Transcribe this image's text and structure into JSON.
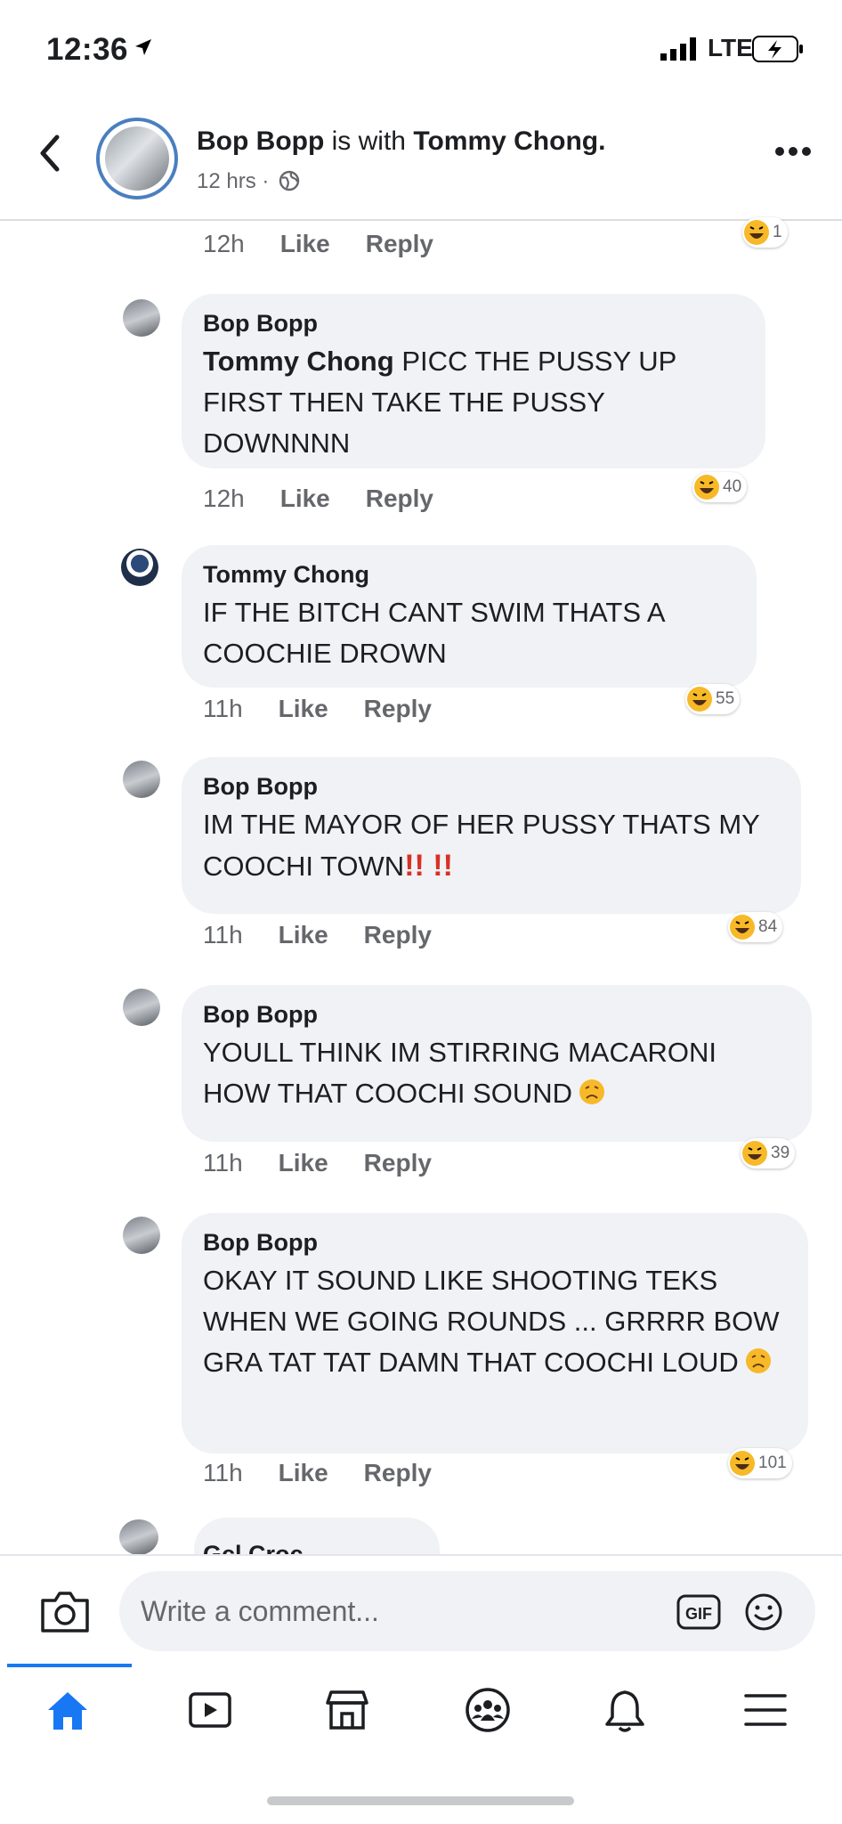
{
  "status_bar": {
    "time": "12:36",
    "network": "LTE"
  },
  "header": {
    "author": "Bop Bopp",
    "with_text": "is with",
    "tagged": "Tommy Chong.",
    "meta": "12 hrs ·"
  },
  "top_row": {
    "time": "12h",
    "like": "Like",
    "reply": "Reply",
    "reaction_count": "1"
  },
  "comments": [
    {
      "author": "Bop Bopp",
      "mention": "Tommy Chong",
      "text": "PICC THE PUSSY UP FIRST THEN TAKE THE PUSSY DOWNNNN",
      "time": "12h",
      "like": "Like",
      "reply": "Reply",
      "reaction_count": "40"
    },
    {
      "author": "Tommy Chong",
      "text": "IF THE BITCH CANT SWIM THATS A COOCHIE DROWN",
      "time": "11h",
      "like": "Like",
      "reply": "Reply",
      "reaction_count": "55"
    },
    {
      "author": "Bop Bopp",
      "text": "IM THE MAYOR OF HER PUSSY THATS MY COOCHI TOWN",
      "emphasis": "!! !!",
      "time": "11h",
      "like": "Like",
      "reply": "Reply",
      "reaction_count": "84"
    },
    {
      "author": "Bop Bopp",
      "text": "YOULL THINK IM STIRRING MACARONI HOW THAT COOCHI SOUND",
      "time": "11h",
      "like": "Like",
      "reply": "Reply",
      "reaction_count": "39"
    },
    {
      "author": "Bop Bopp",
      "text": "OKAY IT SOUND LIKE SHOOTING TEKS WHEN WE GOING ROUNDS ... GRRRR BOW GRA TAT TAT DAMN THAT COOCHI LOUD",
      "time": "11h",
      "like": "Like",
      "reply": "Reply",
      "reaction_count": "101"
    }
  ],
  "partial_comment": {
    "author": "Gcl Croc"
  },
  "composer": {
    "placeholder": "Write a comment...",
    "gif_label": "GIF"
  },
  "colors": {
    "accent": "#1877f2",
    "bubble": "#f0f2f5",
    "meta": "#65676b",
    "emphasis": "#d93025"
  },
  "icons": [
    "back-arrow-icon",
    "globe-icon",
    "more-icon",
    "laugh-reaction-icon",
    "sad-emoji-icon",
    "camera-icon",
    "gif-icon",
    "smiley-icon",
    "home-icon",
    "watch-icon",
    "marketplace-icon",
    "groups-icon",
    "bell-icon",
    "menu-icon"
  ]
}
